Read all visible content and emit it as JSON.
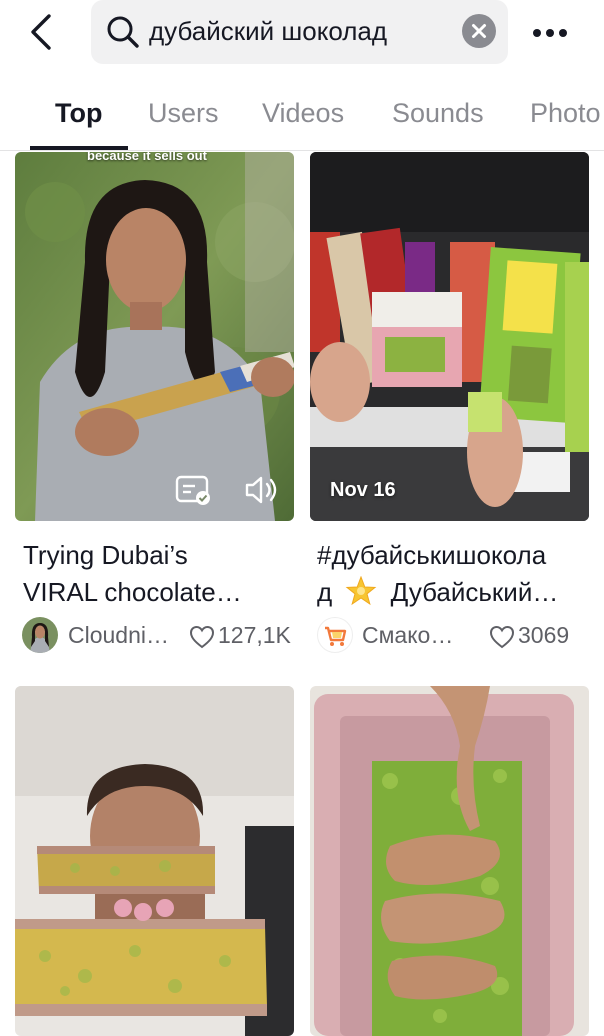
{
  "search": {
    "query": "дубайский шоколад"
  },
  "tabs": [
    {
      "label": "Top"
    },
    {
      "label": "Users"
    },
    {
      "label": "Videos"
    },
    {
      "label": "Sounds"
    },
    {
      "label": "Photo"
    }
  ],
  "cards": [
    {
      "overlay_caption": "because it sells out",
      "title_line1": "Trying Dubai’s",
      "title_line2": "VIRAL chocolate…",
      "author": "Cloudni…",
      "likes": "127,1K",
      "icons": [
        "captions-icon",
        "sound-icon"
      ]
    },
    {
      "overlay_date": "Nov 16",
      "title_line1": "#дубайськишокола",
      "title_line2_pre": "д",
      "title_line2_post": "Дубайський…",
      "author": "Смако…",
      "likes": "3069"
    }
  ],
  "colors": {
    "text_primary": "#161823",
    "text_secondary": "#8a8b91",
    "search_bg": "#f1f1f2"
  }
}
